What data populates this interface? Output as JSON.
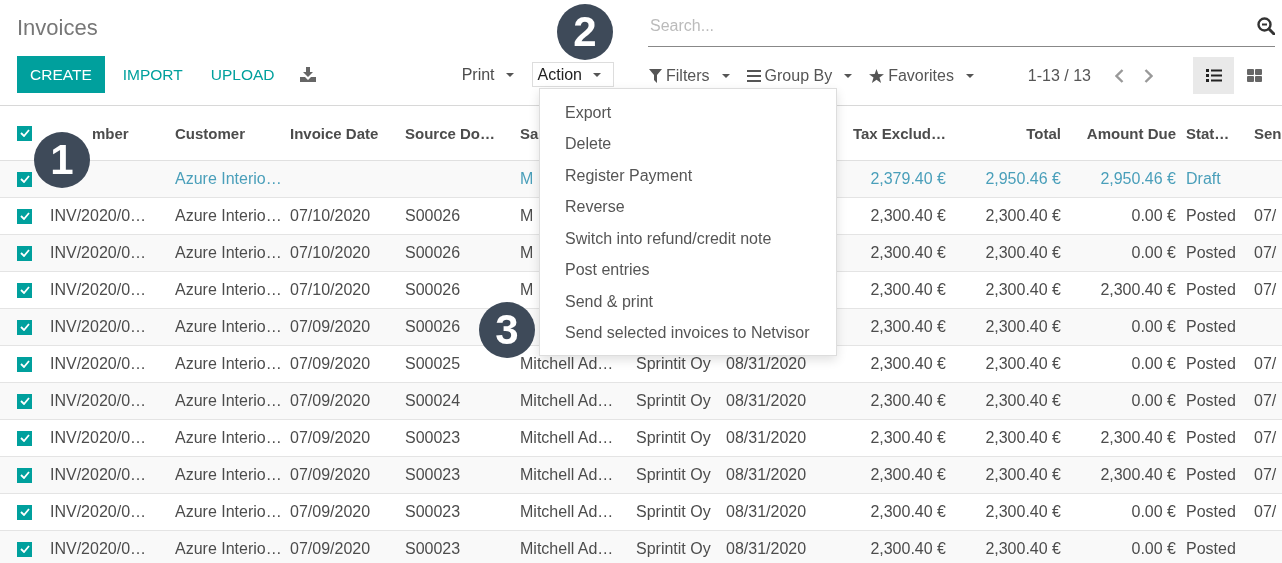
{
  "title": "Invoices",
  "buttons": [
    {
      "label": "CREATE",
      "kind": "primary"
    },
    {
      "label": "IMPORT",
      "kind": "link"
    },
    {
      "label": "UPLOAD",
      "kind": "link"
    }
  ],
  "menus": [
    {
      "label": "Print",
      "expanded": false
    },
    {
      "label": "Action",
      "expanded": true
    }
  ],
  "action_menu": [
    "Export",
    "Delete",
    "Register Payment",
    "Reverse",
    "Switch into refund/credit note",
    "Post entries",
    "Send & print",
    "Send selected invoices to Netvisor"
  ],
  "search": {
    "placeholder": "Search..."
  },
  "search_options": [
    {
      "label": "Filters",
      "kind": "filter"
    },
    {
      "label": "Group By",
      "kind": "group"
    },
    {
      "label": "Favorites",
      "kind": "favorite"
    }
  ],
  "pager": "1-13 / 13",
  "views": [
    {
      "kind": "list",
      "selected": true
    },
    {
      "kind": "kanban",
      "selected": false
    }
  ],
  "table": {
    "all_checked": true,
    "columns": [
      {
        "label": "mber"
      },
      {
        "label": "Customer"
      },
      {
        "label": "Invoice Date"
      },
      {
        "label": "Source Do…"
      },
      {
        "label": "Sa"
      },
      {},
      {},
      {
        "label": "Tax Exclud…"
      },
      {
        "label": "Total"
      },
      {
        "label": "Amount Due"
      },
      {
        "label": "Stat…"
      },
      {
        "label": "Sen"
      }
    ],
    "rows": [
      {
        "checked": true,
        "kind": "draft",
        "customer": "Azure Interio…",
        "salesperson": "M",
        "tax_excluded": "2,379.40 €",
        "total": "2,950.46 €",
        "amount_due": "2,950.46 €",
        "status": "Draft"
      },
      {
        "checked": true,
        "kind": "posted",
        "number": "INV/2020/0…",
        "customer": "Azure Interio…",
        "invoice_date": "07/10/2020",
        "source": "S00026",
        "salesperson": "M",
        "tax_excluded": "2,300.40 €",
        "total": "2,300.40 €",
        "amount_due": "0.00 €",
        "status": "Posted",
        "column_13": "07/"
      },
      {
        "checked": true,
        "kind": "posted",
        "number": "INV/2020/0…",
        "customer": "Azure Interio…",
        "invoice_date": "07/10/2020",
        "source": "S00026",
        "salesperson": "M",
        "tax_excluded": "2,300.40 €",
        "total": "2,300.40 €",
        "amount_due": "0.00 €",
        "status": "Posted",
        "column_13": "07/"
      },
      {
        "checked": true,
        "kind": "posted",
        "number": "INV/2020/0…",
        "customer": "Azure Interio…",
        "invoice_date": "07/10/2020",
        "source": "S00026",
        "salesperson": "M",
        "tax_excluded": "2,300.40 €",
        "total": "2,300.40 €",
        "amount_due": "2,300.40 €",
        "status": "Posted",
        "column_13": "07/"
      },
      {
        "checked": true,
        "kind": "posted",
        "number": "INV/2020/0…",
        "customer": "Azure Interio…",
        "invoice_date": "07/09/2020",
        "source": "S00026",
        "tax_excluded": "2,300.40 €",
        "total": "2,300.40 €",
        "amount_due": "0.00 €",
        "status": "Posted"
      },
      {
        "checked": true,
        "kind": "posted",
        "number": "INV/2020/0…",
        "customer": "Azure Interio…",
        "invoice_date": "07/09/2020",
        "source": "S00025",
        "salesperson": "Mitchell Ad…",
        "company": "Sprintit Oy",
        "due_date": "08/31/2020",
        "tax_excluded": "2,300.40 €",
        "total": "2,300.40 €",
        "amount_due": "0.00 €",
        "status": "Posted",
        "column_13": "07/"
      },
      {
        "checked": true,
        "kind": "posted",
        "number": "INV/2020/0…",
        "customer": "Azure Interio…",
        "invoice_date": "07/09/2020",
        "source": "S00024",
        "salesperson": "Mitchell Ad…",
        "company": "Sprintit Oy",
        "due_date": "08/31/2020",
        "tax_excluded": "2,300.40 €",
        "total": "2,300.40 €",
        "amount_due": "0.00 €",
        "status": "Posted",
        "column_13": "07/"
      },
      {
        "checked": true,
        "kind": "posted",
        "number": "INV/2020/0…",
        "customer": "Azure Interio…",
        "invoice_date": "07/09/2020",
        "source": "S00023",
        "salesperson": "Mitchell Ad…",
        "company": "Sprintit Oy",
        "due_date": "08/31/2020",
        "tax_excluded": "2,300.40 €",
        "total": "2,300.40 €",
        "amount_due": "2,300.40 €",
        "status": "Posted",
        "column_13": "07/"
      },
      {
        "checked": true,
        "kind": "posted",
        "number": "INV/2020/0…",
        "customer": "Azure Interio…",
        "invoice_date": "07/09/2020",
        "source": "S00023",
        "salesperson": "Mitchell Ad…",
        "company": "Sprintit Oy",
        "due_date": "08/31/2020",
        "tax_excluded": "2,300.40 €",
        "total": "2,300.40 €",
        "amount_due": "2,300.40 €",
        "status": "Posted",
        "column_13": "07/"
      },
      {
        "checked": true,
        "kind": "posted",
        "number": "INV/2020/0…",
        "customer": "Azure Interio…",
        "invoice_date": "07/09/2020",
        "source": "S00023",
        "salesperson": "Mitchell Ad…",
        "company": "Sprintit Oy",
        "due_date": "08/31/2020",
        "tax_excluded": "2,300.40 €",
        "total": "2,300.40 €",
        "amount_due": "0.00 €",
        "status": "Posted",
        "column_13": "07/"
      },
      {
        "checked": true,
        "kind": "posted",
        "number": "INV/2020/0…",
        "customer": "Azure Interio…",
        "invoice_date": "07/09/2020",
        "source": "S00023",
        "salesperson": "Mitchell Ad…",
        "company": "Sprintit Oy",
        "due_date": "08/31/2020",
        "tax_excluded": "2,300.40 €",
        "total": "2,300.40 €",
        "amount_due": "0.00 €",
        "status": "Posted"
      }
    ]
  },
  "callouts": [
    "1",
    "2",
    "3"
  ]
}
